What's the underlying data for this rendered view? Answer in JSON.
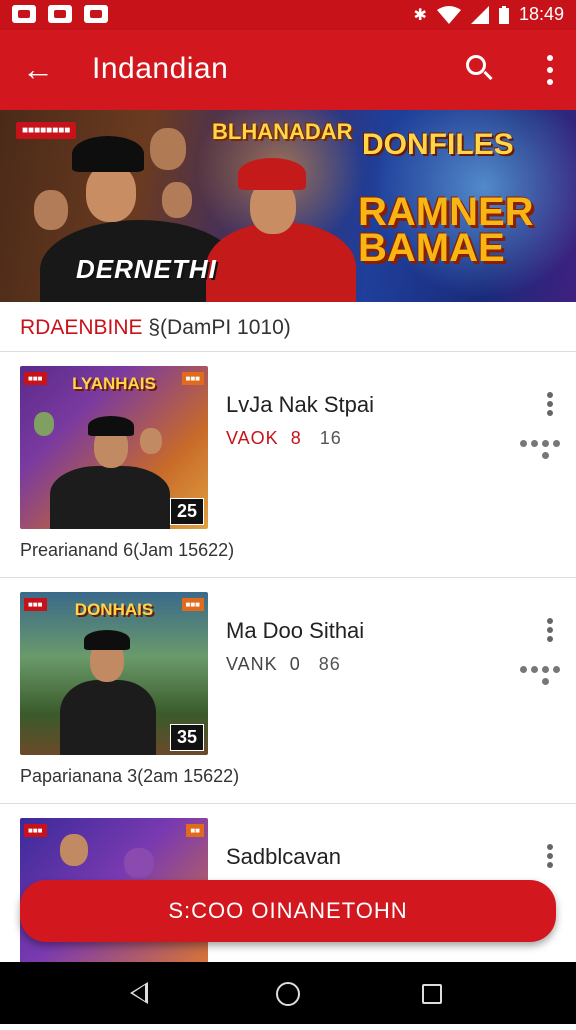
{
  "status_bar": {
    "time": "18:49",
    "icons": [
      "notification-icon",
      "photo-icon",
      "message-icon",
      "bluetooth-icon",
      "wifi-icon",
      "signal-icon",
      "battery-icon"
    ]
  },
  "app_bar": {
    "title": "Indandian",
    "back_icon": "arrow-left-icon",
    "search_icon": "search-icon",
    "more_icon": "more-vert-icon"
  },
  "banner": {
    "corner_tag": "",
    "shirt_text": "DERNETHI",
    "logo_1": "BLHANADAR",
    "logo_2": "DONFILES",
    "logo_3": "RAMNER BAMAE"
  },
  "section": {
    "title": "RDAENBINE",
    "subtitle": "§(DamPI 1010)"
  },
  "games": [
    {
      "title": "LvJa Nak Stpai",
      "meta_label": "VAOK",
      "meta_num": "8",
      "meta_value": "16",
      "meta_red": true,
      "caption": "Prearianand 6(Jam 15622)",
      "thumb_logo": "LYANHAIS",
      "thumb_number": "25"
    },
    {
      "title": "Ma Doo Sithai",
      "meta_label": "VANK",
      "meta_num": "0",
      "meta_value": "86",
      "meta_red": false,
      "caption": "Paparianana 3(2am 15622)",
      "thumb_logo": "DONHAIS",
      "thumb_number": "35"
    },
    {
      "title": "Sadblcavan",
      "meta_label": "",
      "meta_num": "",
      "meta_value": "",
      "meta_red": false,
      "caption": "",
      "thumb_logo": "",
      "thumb_number": ""
    }
  ],
  "fab": {
    "label": "S:COO OINANETOHN"
  },
  "nav_bar": {
    "icons": [
      "nav-back-icon",
      "nav-home-icon",
      "nav-recents-icon"
    ]
  },
  "colors": {
    "primary": "#d3171f",
    "status_bar": "#c8121a",
    "accent_red": "#c8121a",
    "text_dark": "#222222"
  }
}
